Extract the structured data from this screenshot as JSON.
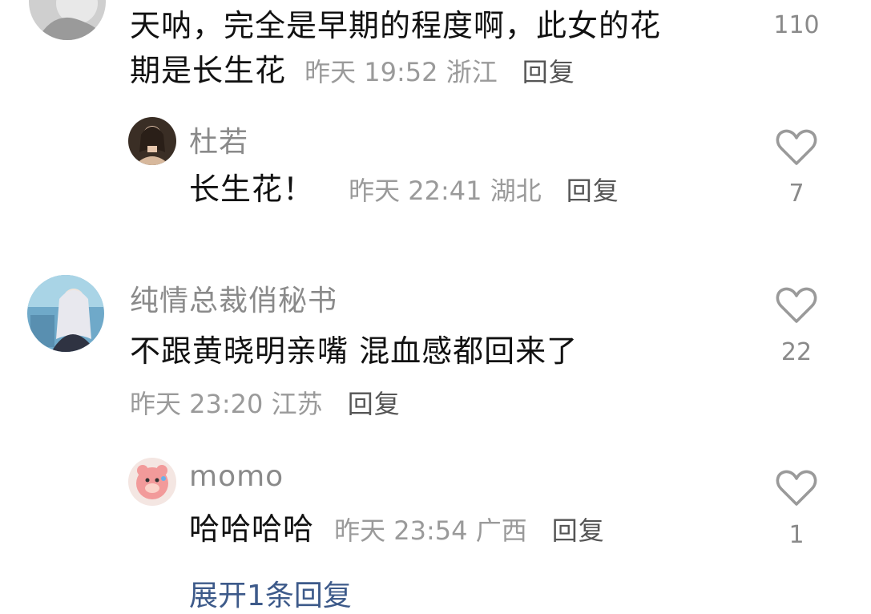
{
  "comments": [
    {
      "content_line1": "天呐，完全是早期的程度啊，此女的花",
      "content_line2": "期是长生花",
      "time": "昨天 19:52",
      "location": "浙江",
      "reply_label": "回复",
      "likes": "110"
    },
    {
      "username": "杜若",
      "content": "长生花！",
      "time": "昨天 22:41",
      "location": "湖北",
      "reply_label": "回复",
      "likes": "7"
    },
    {
      "username": "纯情总裁俏秘书",
      "content": "不跟黄晓明亲嘴 混血感都回来了",
      "time": "昨天 23:20",
      "location": "江苏",
      "reply_label": "回复",
      "likes": "22"
    },
    {
      "username": "momo",
      "content": "哈哈哈哈",
      "time": "昨天 23:54",
      "location": "广西",
      "reply_label": "回复",
      "likes": "1"
    }
  ],
  "expand_replies": "展开1条回复",
  "icons": {
    "like": "heart-outline-icon"
  },
  "colors": {
    "text": "#111111",
    "username": "#8a8a8a",
    "meta": "#9a9a9a",
    "link": "#3d5a8a"
  }
}
